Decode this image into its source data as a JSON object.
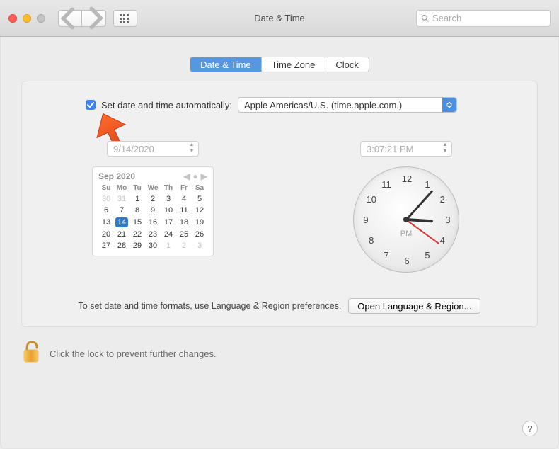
{
  "window": {
    "title": "Date & Time",
    "search_placeholder": "Search"
  },
  "tabs": {
    "items": [
      "Date & Time",
      "Time Zone",
      "Clock"
    ],
    "active": 0
  },
  "auto": {
    "checked": true,
    "label": "Set date and time automatically:",
    "server": "Apple Americas/U.S. (time.apple.com.)"
  },
  "date": {
    "field": "9/14/2020"
  },
  "time": {
    "field": "3:07:21 PM",
    "hour": 3,
    "minute": 7,
    "second": 21,
    "ampm": "PM"
  },
  "calendar": {
    "month_label": "Sep 2020",
    "dow": [
      "Su",
      "Mo",
      "Tu",
      "We",
      "Th",
      "Fr",
      "Sa"
    ],
    "weeks": [
      [
        {
          "d": 30,
          "off": true
        },
        {
          "d": 31,
          "off": true
        },
        {
          "d": 1
        },
        {
          "d": 2
        },
        {
          "d": 3
        },
        {
          "d": 4
        },
        {
          "d": 5
        }
      ],
      [
        {
          "d": 6
        },
        {
          "d": 7
        },
        {
          "d": 8
        },
        {
          "d": 9
        },
        {
          "d": 10
        },
        {
          "d": 11
        },
        {
          "d": 12
        }
      ],
      [
        {
          "d": 13
        },
        {
          "d": 14,
          "sel": true
        },
        {
          "d": 15
        },
        {
          "d": 16
        },
        {
          "d": 17
        },
        {
          "d": 18
        },
        {
          "d": 19
        }
      ],
      [
        {
          "d": 20
        },
        {
          "d": 21
        },
        {
          "d": 22
        },
        {
          "d": 23
        },
        {
          "d": 24
        },
        {
          "d": 25
        },
        {
          "d": 26
        }
      ],
      [
        {
          "d": 27
        },
        {
          "d": 28
        },
        {
          "d": 29
        },
        {
          "d": 30
        },
        {
          "d": 1,
          "off": true
        },
        {
          "d": 2,
          "off": true
        },
        {
          "d": 3,
          "off": true
        }
      ]
    ]
  },
  "footer": {
    "text": "To set date and time formats, use Language & Region preferences.",
    "button": "Open Language & Region..."
  },
  "lock": {
    "text": "Click the lock to prevent further changes."
  },
  "help_label": "?"
}
